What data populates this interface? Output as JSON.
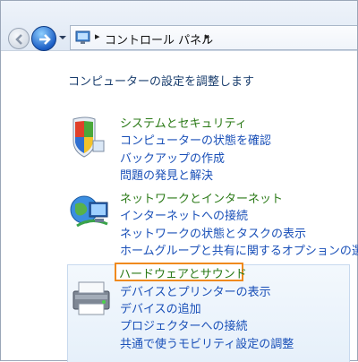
{
  "address_bar": {
    "breadcrumb": "コントロール パネル",
    "sep1": "▸",
    "sep2": "▸"
  },
  "heading": "コンピューターの設定を調整します",
  "categories": [
    {
      "title": "システムとセキュリティ",
      "icon": "security-shield-icon",
      "links": [
        "コンピューターの状態を確認",
        "バックアップの作成",
        "問題の発見と解決"
      ]
    },
    {
      "title": "ネットワークとインターネット",
      "icon": "network-globe-icon",
      "links": [
        "インターネットへの接続",
        "ネットワークの状態とタスクの表示",
        "ホームグループと共有に関するオプションの選択"
      ]
    },
    {
      "title": "ハードウェアとサウンド",
      "icon": "printer-icon",
      "links": [
        "デバイスとプリンターの表示",
        "デバイスの追加",
        "プロジェクターへの接続",
        "共通で使うモビリティ設定の調整"
      ]
    }
  ],
  "colors": {
    "category_title": "#2b7a17",
    "link": "#1a50b8",
    "highlight": "#f08a1e"
  }
}
